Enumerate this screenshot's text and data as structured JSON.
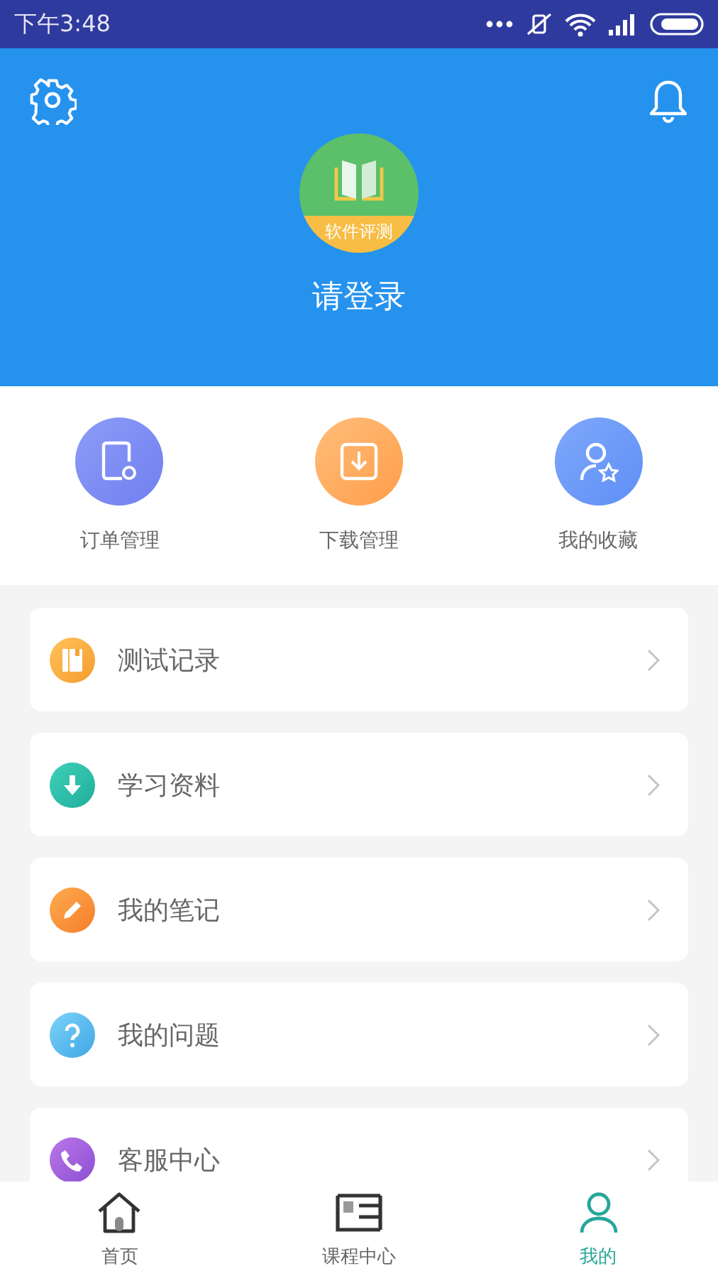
{
  "status_bar": {
    "time": "下午3:48"
  },
  "header": {
    "badge": "软件评测",
    "login": "请登录"
  },
  "quick_actions": [
    {
      "label": "订单管理",
      "kind": "order"
    },
    {
      "label": "下载管理",
      "kind": "download"
    },
    {
      "label": "我的收藏",
      "kind": "favorite"
    }
  ],
  "menu": [
    {
      "label": "测试记录",
      "kind": "record"
    },
    {
      "label": "学习资料",
      "kind": "material"
    },
    {
      "label": "我的笔记",
      "kind": "note"
    },
    {
      "label": "我的问题",
      "kind": "question"
    },
    {
      "label": "客服中心",
      "kind": "service"
    }
  ],
  "tabs": [
    {
      "label": "首页",
      "kind": "home",
      "selected": false
    },
    {
      "label": "课程中心",
      "kind": "course",
      "selected": false
    },
    {
      "label": "我的",
      "kind": "me",
      "selected": true
    }
  ]
}
